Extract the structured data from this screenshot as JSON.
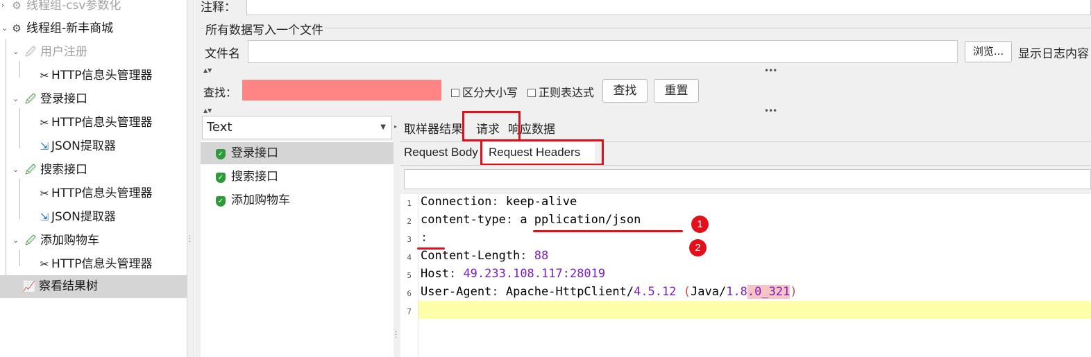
{
  "tree": {
    "items": [
      {
        "label": "线程组-csv参数化",
        "icon": "gear-icon"
      },
      {
        "label": "线程组-新丰商城",
        "icon": "gear-icon"
      },
      {
        "label": "用户注册",
        "icon": "pipette-icon"
      },
      {
        "label": "HTTP信息头管理器",
        "icon": "wrench-icon"
      },
      {
        "label": "登录接口",
        "icon": "pipette-icon"
      },
      {
        "label": "HTTP信息头管理器",
        "icon": "wrench-icon"
      },
      {
        "label": "JSON提取器",
        "icon": "extractor-icon"
      },
      {
        "label": "搜索接口",
        "icon": "pipette-icon"
      },
      {
        "label": "HTTP信息头管理器",
        "icon": "wrench-icon"
      },
      {
        "label": "JSON提取器",
        "icon": "extractor-icon"
      },
      {
        "label": "添加购物车",
        "icon": "pipette-icon"
      },
      {
        "label": "HTTP信息头管理器",
        "icon": "wrench-icon"
      },
      {
        "label": "察看结果树",
        "icon": "chart-icon"
      }
    ]
  },
  "config": {
    "comment_label": "注释：",
    "group_title": "所有数据写入一个文件",
    "filename_label": "文件名",
    "browse_button": "浏览...",
    "log_label": "显示日志内容"
  },
  "search": {
    "label": "查找：",
    "case_label": "区分大小写",
    "regex_label": "正则表达式",
    "find_button": "查找",
    "reset_button": "重置",
    "field_color": "#ff8585"
  },
  "results": {
    "renderer": "Text",
    "items": [
      "登录接口",
      "搜索接口",
      "添加购物车"
    ]
  },
  "tabs": {
    "sampler_result": "取样器结果",
    "request": "请求",
    "response": "响应数据"
  },
  "subtabs": {
    "body": "Request Body",
    "headers": "Request Headers"
  },
  "editor": {
    "line_numbers": [
      "1",
      "2",
      "3",
      "4",
      "5",
      "6",
      "7"
    ],
    "lines": [
      {
        "key": "Connection",
        "sep": ": ",
        "value": "keep-alive"
      },
      {
        "key": "content-type",
        "sep": ": ",
        "value": "a pplication/json"
      },
      {
        "key": "",
        "sep": ":",
        "value": ""
      },
      {
        "key": "Content-Length",
        "sep": ": ",
        "value": "88"
      },
      {
        "key": "Host",
        "sep": ": ",
        "value": "49.233.108.117:28019"
      },
      {
        "key": "User-Agent",
        "sep": ": ",
        "value_parts": [
          "Apache-HttpClient/",
          "4.5.12",
          " ",
          "(",
          "Java/",
          "1.8",
          ".0_321",
          ")"
        ]
      }
    ]
  },
  "annotations": {
    "marker_1": "1",
    "marker_2": "2",
    "color": "#e3101c"
  }
}
